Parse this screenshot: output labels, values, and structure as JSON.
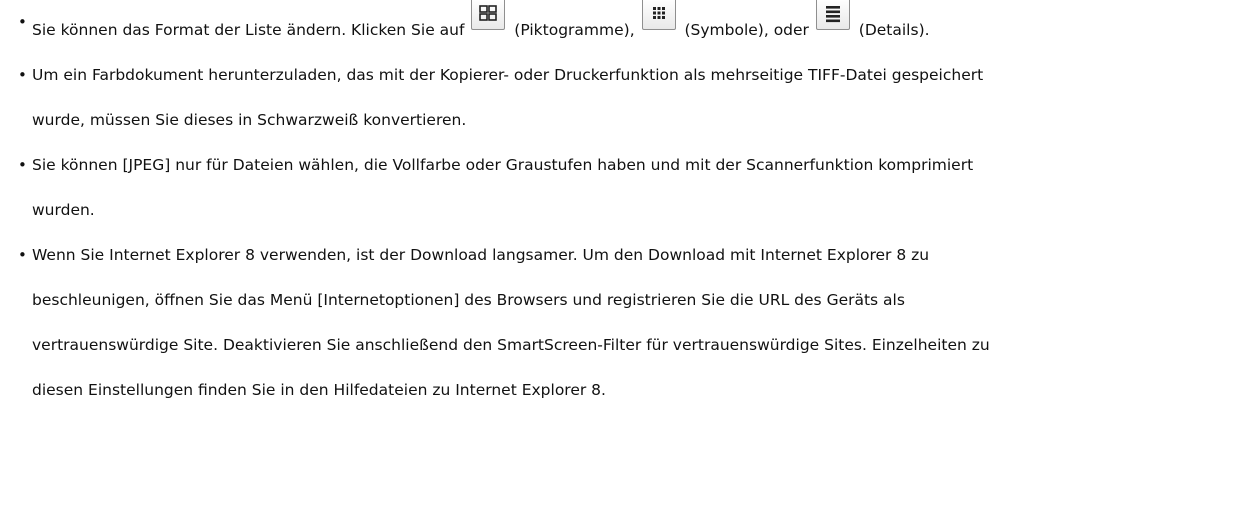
{
  "notes": [
    {
      "lines": [
        {
          "segments": [
            {
              "type": "text",
              "text": "Sie können das Format der Liste ändern. Klicken Sie auf "
            },
            {
              "type": "icon",
              "icon": "thumbnail-view-icon"
            },
            {
              "type": "text",
              "text": " (Piktogramme), "
            },
            {
              "type": "icon",
              "icon": "icon-view-icon"
            },
            {
              "type": "text",
              "text": " (Symbole), oder "
            },
            {
              "type": "icon",
              "icon": "details-view-icon"
            },
            {
              "type": "text",
              "text": " (Details)."
            }
          ]
        }
      ]
    },
    {
      "lines": [
        "Um ein Farbdokument herunterzuladen, das mit der Kopierer- oder Druckerfunktion als mehrseitige TIFF-Datei gespeichert",
        "wurde, müssen Sie dieses in Schwarzweiß konvertieren."
      ]
    },
    {
      "lines": [
        "Sie können [JPEG] nur für Dateien wählen, die Vollfarbe oder Graustufen haben und mit der Scannerfunktion komprimiert",
        "wurden."
      ]
    },
    {
      "lines": [
        "Wenn Sie Internet Explorer 8 verwenden, ist der Download langsamer. Um den Download mit Internet Explorer 8 zu",
        "beschleunigen, öffnen Sie das Menü [Internetoptionen] des Browsers und registrieren Sie die URL des Geräts als",
        "vertrauenswürdige Site. Deaktivieren Sie anschließend den SmartScreen-Filter für vertrauenswürdige Sites. Einzelheiten zu",
        "diesen Einstellungen finden Sie in den Hilfedateien zu Internet Explorer 8."
      ]
    }
  ]
}
